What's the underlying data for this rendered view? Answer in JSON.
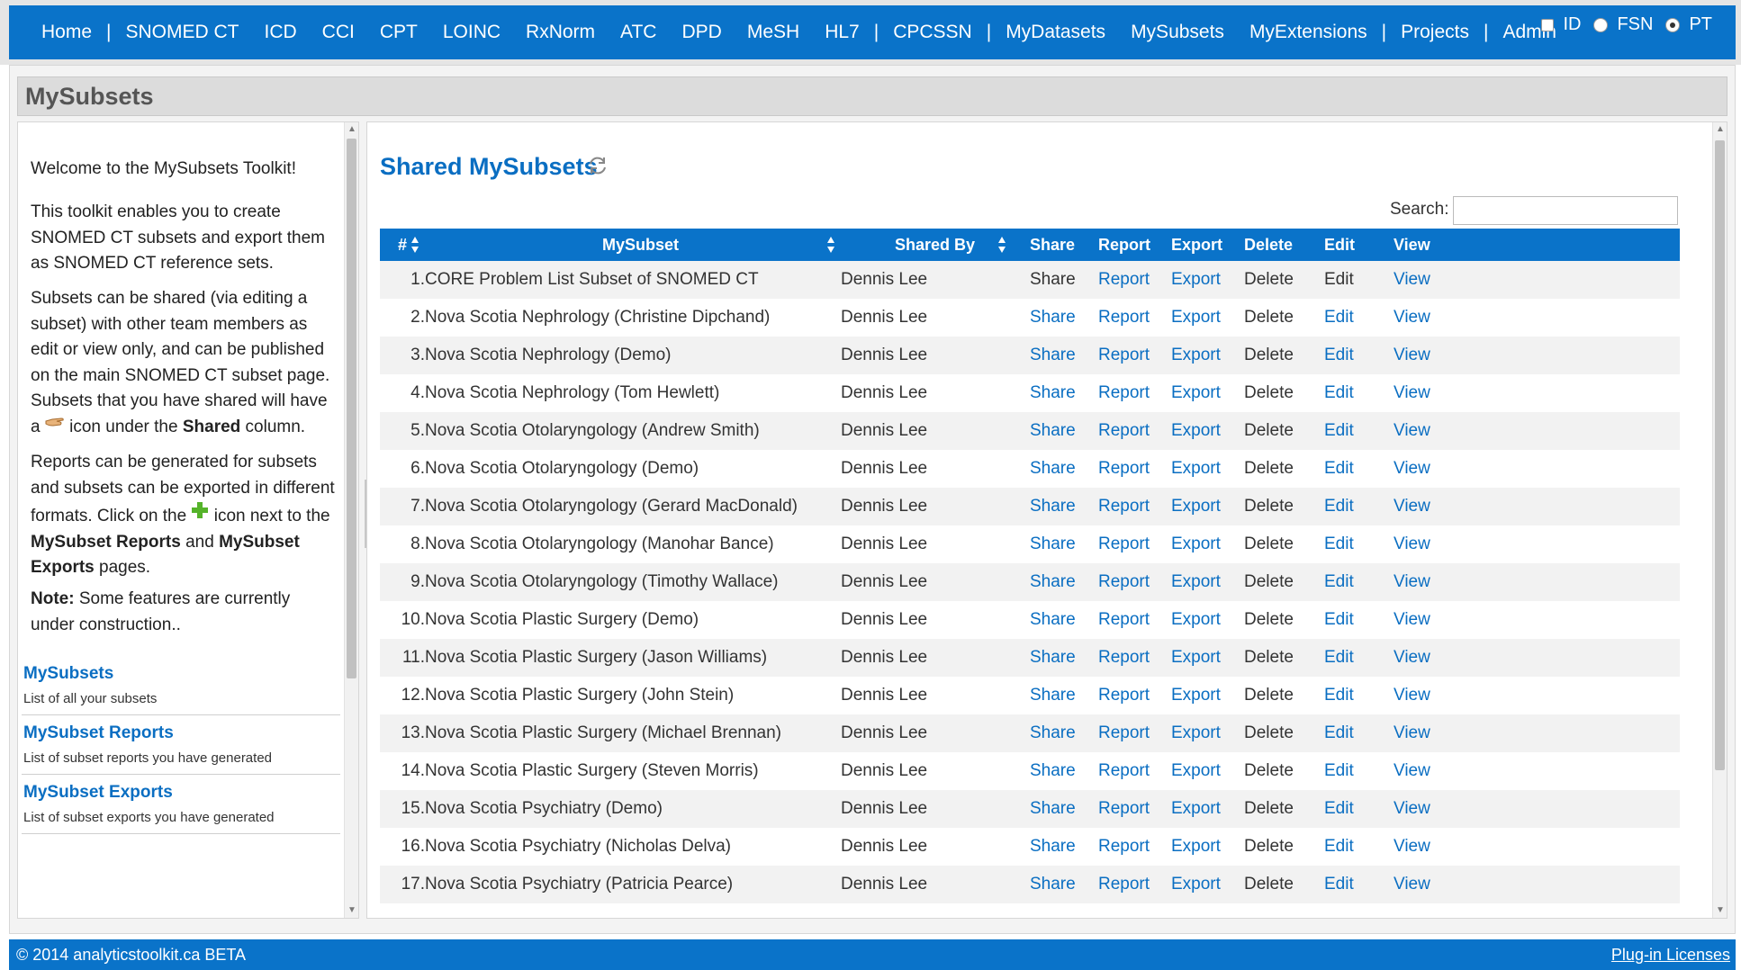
{
  "nav": {
    "items": [
      {
        "label": "Home",
        "sep_after": true
      },
      {
        "label": "SNOMED CT",
        "sep_after": false
      },
      {
        "label": "ICD",
        "sep_after": false
      },
      {
        "label": "CCI",
        "sep_after": false
      },
      {
        "label": "CPT",
        "sep_after": false
      },
      {
        "label": "LOINC",
        "sep_after": false
      },
      {
        "label": "RxNorm",
        "sep_after": false
      },
      {
        "label": "ATC",
        "sep_after": false
      },
      {
        "label": "DPD",
        "sep_after": false
      },
      {
        "label": "MeSH",
        "sep_after": false
      },
      {
        "label": "HL7",
        "sep_after": true
      },
      {
        "label": "CPCSSN",
        "sep_after": true
      },
      {
        "label": "MyDatasets",
        "sep_after": false
      },
      {
        "label": "MySubsets",
        "sep_after": false
      },
      {
        "label": "MyExtensions",
        "sep_after": true
      },
      {
        "label": "Projects",
        "sep_after": true
      },
      {
        "label": "Admin",
        "sep_after": false
      }
    ],
    "separator": "|",
    "display_options": {
      "id_label": "ID",
      "id_checked": false,
      "fsn_label": "FSN",
      "pt_label": "PT",
      "selected": "PT"
    }
  },
  "page": {
    "title": "MySubsets"
  },
  "sidebar": {
    "welcome": "Welcome to the MySubsets Toolkit!",
    "intro": "This toolkit enables you to create SNOMED CT subsets and export them as SNOMED CT reference sets.",
    "sharing_1": "Subsets can be shared (via editing a subset) with other team members as edit or view only, and can be published on the main SNOMED CT subset page. Subsets that you have shared will have a",
    "sharing_2": "icon under the",
    "sharing_bold": "Shared",
    "sharing_3": "column.",
    "reports_1": "Reports can be generated for subsets and subsets can be exported in different formats. Click on the",
    "reports_2": "icon next to the",
    "reports_bold_1": "MySubset Reports",
    "reports_3": "and",
    "reports_bold_2": "MySubset Exports",
    "reports_4": "pages.",
    "note_bold": "Note:",
    "note_text": "Some features are currently under construction..",
    "links": [
      {
        "label": "MySubsets",
        "desc": "List of all your subsets"
      },
      {
        "label": "MySubset Reports",
        "desc": "List of subset reports you have generated"
      },
      {
        "label": "MySubset Exports",
        "desc": "List of subset exports you have generated"
      }
    ]
  },
  "main": {
    "section_title": "Shared MySubsets",
    "search_label": "Search:",
    "search_value": "",
    "columns": [
      "#",
      "MySubset",
      "Shared By",
      "Share",
      "Report",
      "Export",
      "Delete",
      "Edit",
      "View"
    ],
    "rows": [
      {
        "num": "1.",
        "name": "CORE Problem List Subset of SNOMED CT",
        "shared_by": "Dennis Lee",
        "share": "Share",
        "report": "Report",
        "export": "Export",
        "delete": "Delete",
        "edit": "Edit",
        "view": "View",
        "share_link": false,
        "edit_link": false
      },
      {
        "num": "2.",
        "name": "Nova Scotia Nephrology (Christine Dipchand)",
        "shared_by": "Dennis Lee",
        "share": "Share",
        "report": "Report",
        "export": "Export",
        "delete": "Delete",
        "edit": "Edit",
        "view": "View",
        "share_link": true,
        "edit_link": true
      },
      {
        "num": "3.",
        "name": "Nova Scotia Nephrology (Demo)",
        "shared_by": "Dennis Lee",
        "share": "Share",
        "report": "Report",
        "export": "Export",
        "delete": "Delete",
        "edit": "Edit",
        "view": "View",
        "share_link": true,
        "edit_link": true
      },
      {
        "num": "4.",
        "name": "Nova Scotia Nephrology (Tom Hewlett)",
        "shared_by": "Dennis Lee",
        "share": "Share",
        "report": "Report",
        "export": "Export",
        "delete": "Delete",
        "edit": "Edit",
        "view": "View",
        "share_link": true,
        "edit_link": true
      },
      {
        "num": "5.",
        "name": "Nova Scotia Otolaryngology (Andrew Smith)",
        "shared_by": "Dennis Lee",
        "share": "Share",
        "report": "Report",
        "export": "Export",
        "delete": "Delete",
        "edit": "Edit",
        "view": "View",
        "share_link": true,
        "edit_link": true
      },
      {
        "num": "6.",
        "name": "Nova Scotia Otolaryngology (Demo)",
        "shared_by": "Dennis Lee",
        "share": "Share",
        "report": "Report",
        "export": "Export",
        "delete": "Delete",
        "edit": "Edit",
        "view": "View",
        "share_link": true,
        "edit_link": true
      },
      {
        "num": "7.",
        "name": "Nova Scotia Otolaryngology (Gerard MacDonald)",
        "shared_by": "Dennis Lee",
        "share": "Share",
        "report": "Report",
        "export": "Export",
        "delete": "Delete",
        "edit": "Edit",
        "view": "View",
        "share_link": true,
        "edit_link": true
      },
      {
        "num": "8.",
        "name": "Nova Scotia Otolaryngology (Manohar Bance)",
        "shared_by": "Dennis Lee",
        "share": "Share",
        "report": "Report",
        "export": "Export",
        "delete": "Delete",
        "edit": "Edit",
        "view": "View",
        "share_link": true,
        "edit_link": true
      },
      {
        "num": "9.",
        "name": "Nova Scotia Otolaryngology (Timothy Wallace)",
        "shared_by": "Dennis Lee",
        "share": "Share",
        "report": "Report",
        "export": "Export",
        "delete": "Delete",
        "edit": "Edit",
        "view": "View",
        "share_link": true,
        "edit_link": true
      },
      {
        "num": "10.",
        "name": "Nova Scotia Plastic Surgery (Demo)",
        "shared_by": "Dennis Lee",
        "share": "Share",
        "report": "Report",
        "export": "Export",
        "delete": "Delete",
        "edit": "Edit",
        "view": "View",
        "share_link": true,
        "edit_link": true
      },
      {
        "num": "11.",
        "name": "Nova Scotia Plastic Surgery (Jason Williams)",
        "shared_by": "Dennis Lee",
        "share": "Share",
        "report": "Report",
        "export": "Export",
        "delete": "Delete",
        "edit": "Edit",
        "view": "View",
        "share_link": true,
        "edit_link": true
      },
      {
        "num": "12.",
        "name": "Nova Scotia Plastic Surgery (John Stein)",
        "shared_by": "Dennis Lee",
        "share": "Share",
        "report": "Report",
        "export": "Export",
        "delete": "Delete",
        "edit": "Edit",
        "view": "View",
        "share_link": true,
        "edit_link": true
      },
      {
        "num": "13.",
        "name": "Nova Scotia Plastic Surgery (Michael Brennan)",
        "shared_by": "Dennis Lee",
        "share": "Share",
        "report": "Report",
        "export": "Export",
        "delete": "Delete",
        "edit": "Edit",
        "view": "View",
        "share_link": true,
        "edit_link": true
      },
      {
        "num": "14.",
        "name": "Nova Scotia Plastic Surgery (Steven Morris)",
        "shared_by": "Dennis Lee",
        "share": "Share",
        "report": "Report",
        "export": "Export",
        "delete": "Delete",
        "edit": "Edit",
        "view": "View",
        "share_link": true,
        "edit_link": true
      },
      {
        "num": "15.",
        "name": "Nova Scotia Psychiatry (Demo)",
        "shared_by": "Dennis Lee",
        "share": "Share",
        "report": "Report",
        "export": "Export",
        "delete": "Delete",
        "edit": "Edit",
        "view": "View",
        "share_link": true,
        "edit_link": true
      },
      {
        "num": "16.",
        "name": "Nova Scotia Psychiatry (Nicholas Delva)",
        "shared_by": "Dennis Lee",
        "share": "Share",
        "report": "Report",
        "export": "Export",
        "delete": "Delete",
        "edit": "Edit",
        "view": "View",
        "share_link": true,
        "edit_link": true
      },
      {
        "num": "17.",
        "name": "Nova Scotia Psychiatry (Patricia Pearce)",
        "shared_by": "Dennis Lee",
        "share": "Share",
        "report": "Report",
        "export": "Export",
        "delete": "Delete",
        "edit": "Edit",
        "view": "View",
        "share_link": true,
        "edit_link": true
      }
    ]
  },
  "footer": {
    "copyright": "© 2014 analyticstoolkit.ca BETA",
    "plugin_link": "Plug-in Licenses"
  },
  "colors": {
    "brand_blue": "#0a73c9",
    "link_blue": "#0a6ec2",
    "row_stripe": "#f2f2f2"
  }
}
